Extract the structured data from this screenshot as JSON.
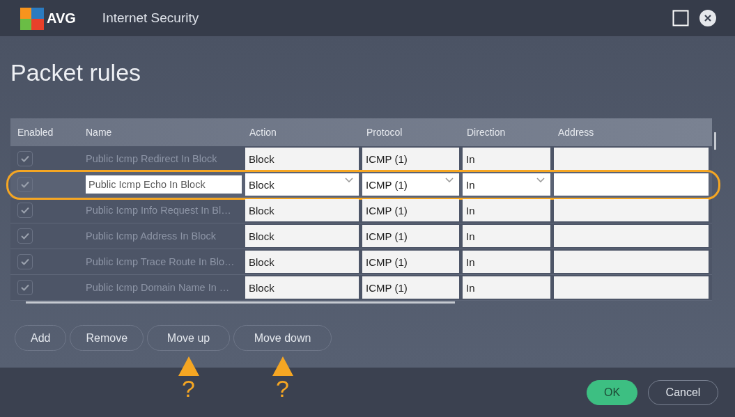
{
  "window": {
    "logo": "AVG",
    "title": "Internet Security"
  },
  "page_title": "Packet rules",
  "table": {
    "columns": [
      "Enabled",
      "Name",
      "Action",
      "Protocol",
      "Direction",
      "Address"
    ],
    "rows": [
      {
        "enabled": true,
        "selected": false,
        "highlighted": false,
        "name": "Public Icmp Redirect In Block",
        "action": "Block",
        "protocol": "ICMP (1)",
        "direction": "In"
      },
      {
        "enabled": true,
        "selected": true,
        "highlighted": true,
        "name": "Public Icmp Echo In Block",
        "action": "Block",
        "protocol": "ICMP (1)",
        "direction": "In"
      },
      {
        "enabled": true,
        "selected": false,
        "highlighted": false,
        "name": "Public Icmp Info Request In Bl…",
        "action": "Block",
        "protocol": "ICMP (1)",
        "direction": "In"
      },
      {
        "enabled": true,
        "selected": false,
        "highlighted": false,
        "name": "Public Icmp Address In Block",
        "action": "Block",
        "protocol": "ICMP (1)",
        "direction": "In"
      },
      {
        "enabled": true,
        "selected": false,
        "highlighted": false,
        "name": "Public Icmp Trace Route In Blo…",
        "action": "Block",
        "protocol": "ICMP (1)",
        "direction": "In"
      },
      {
        "enabled": true,
        "selected": false,
        "highlighted": false,
        "name": "Public Icmp Domain Name In …",
        "action": "Block",
        "protocol": "ICMP (1)",
        "direction": "In"
      }
    ]
  },
  "row_buttons": [
    {
      "label": "Add"
    },
    {
      "label": "Remove"
    },
    {
      "label": "Move up",
      "marker": "?"
    },
    {
      "label": "Move down",
      "marker": "?"
    }
  ],
  "footer_buttons": [
    {
      "label": "OK",
      "kind": "primary"
    },
    {
      "label": "Cancel",
      "kind": "secondary"
    }
  ]
}
